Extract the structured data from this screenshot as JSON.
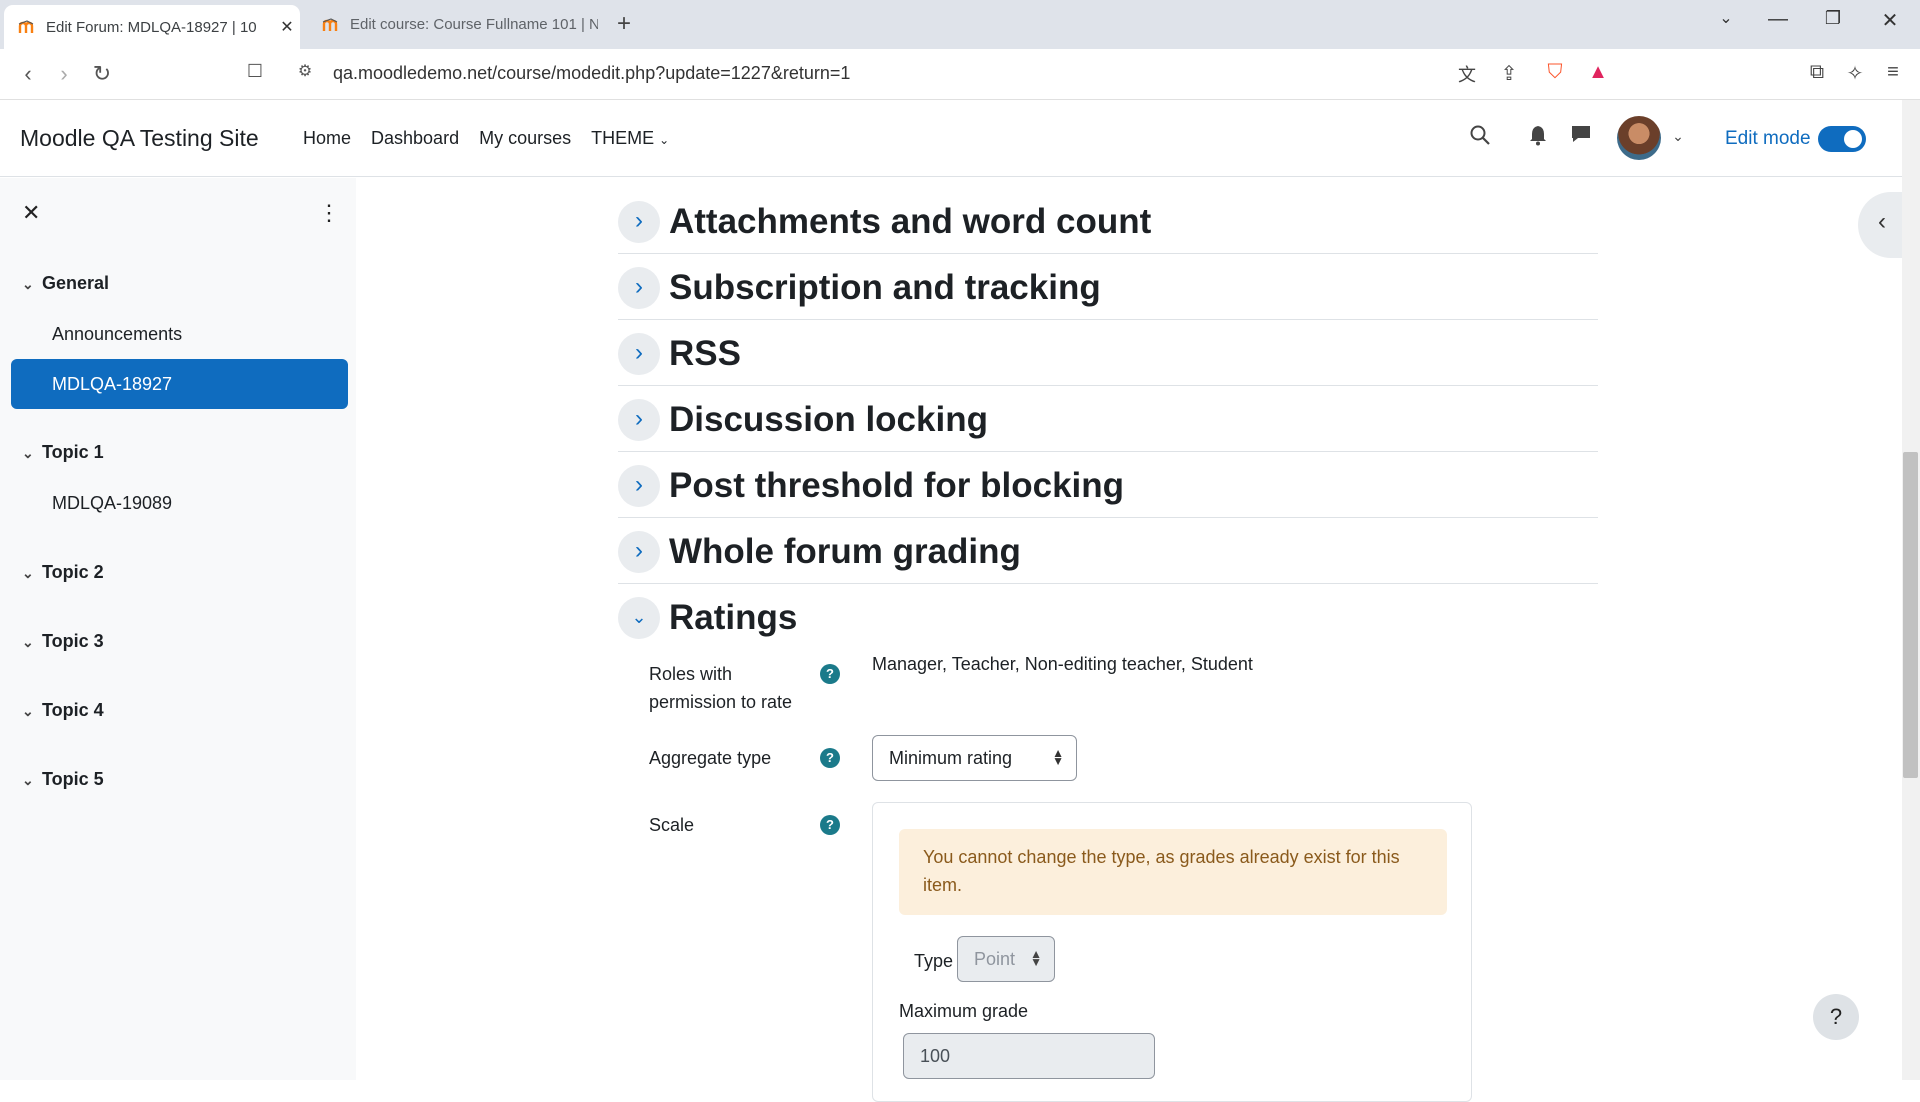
{
  "browser": {
    "tabs": [
      {
        "title": "Edit Forum: MDLQA-18927 | 10",
        "active": true
      },
      {
        "title": "Edit course: Course Fullname 101 | N",
        "active": false
      }
    ],
    "url": "qa.moodledemo.net/course/modedit.php?update=1227&return=1"
  },
  "navbar": {
    "site_name": "Moodle QA Testing Site",
    "menu": [
      "Home",
      "Dashboard",
      "My courses",
      "THEME"
    ],
    "edit_mode_label": "Edit mode",
    "edit_mode_on": true
  },
  "sidebar": {
    "sections": [
      {
        "title": "General",
        "items": [
          "Announcements",
          "MDLQA-18927"
        ]
      },
      {
        "title": "Topic 1",
        "items": [
          "MDLQA-19089"
        ]
      },
      {
        "title": "Topic 2",
        "items": []
      },
      {
        "title": "Topic 3",
        "items": []
      },
      {
        "title": "Topic 4",
        "items": []
      },
      {
        "title": "Topic 5",
        "items": []
      }
    ],
    "selected_item": "MDLQA-18927"
  },
  "form": {
    "sections": [
      {
        "title": "Attachments and word count",
        "expanded": false
      },
      {
        "title": "Subscription and tracking",
        "expanded": false
      },
      {
        "title": "RSS",
        "expanded": false
      },
      {
        "title": "Discussion locking",
        "expanded": false
      },
      {
        "title": "Post threshold for blocking",
        "expanded": false
      },
      {
        "title": "Whole forum grading",
        "expanded": false
      },
      {
        "title": "Ratings",
        "expanded": true
      }
    ],
    "ratings": {
      "roles_label_1": "Roles with",
      "roles_label_2": "permission to rate",
      "roles_value": "Manager, Teacher, Non-editing teacher, Student",
      "aggregate_label": "Aggregate type",
      "aggregate_value": "Minimum rating",
      "scale_label": "Scale",
      "alert_text": "You cannot change the type, as grades already exist for this item.",
      "type_label": "Type",
      "type_value": "Point",
      "max_grade_label": "Maximum grade",
      "max_grade_value": "100"
    }
  },
  "help_glyph": "?"
}
